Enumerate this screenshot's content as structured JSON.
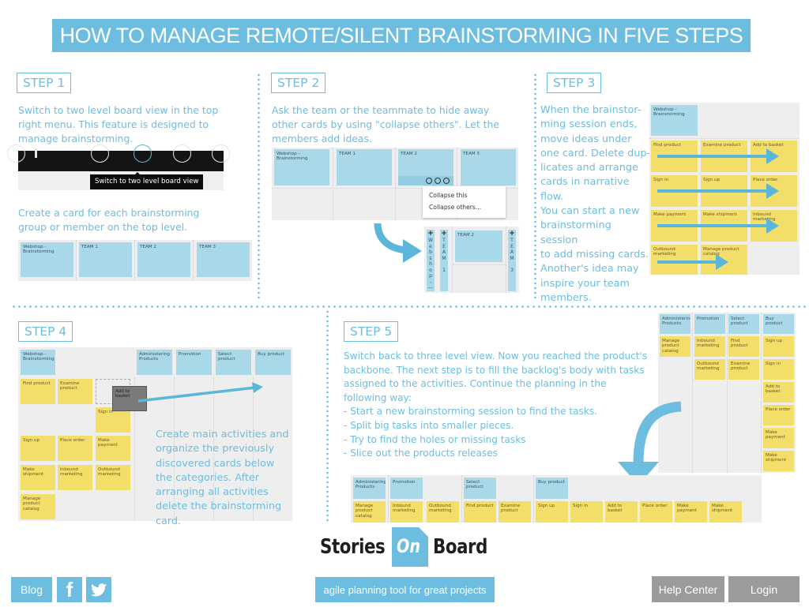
{
  "title": "HOW TO MANAGE REMOTE/SILENT BRAINSTORMING IN FIVE STEPS",
  "colors": {
    "accent": "#6cbde0",
    "card_blue": "#a9d8e8",
    "card_yellow": "#f3de6a",
    "button_gray": "#9b9b9b",
    "board_bg": "#eeeeee"
  },
  "step1": {
    "label": "STEP 1",
    "text1": "Switch to two level board view in the top right menu. This feature is designed to manage brainstorming.",
    "tooltip": "Switch to two level board view",
    "text2": "Create a card for each brainstorming group or member on the top level.",
    "cards": [
      "Webshop - Brainstorming",
      "TEAM 1",
      "TEAM 2",
      "TEAM 3"
    ]
  },
  "step2": {
    "label": "STEP 2",
    "text": "Ask the team or the teammate to hide away other cards by using \"collapse others\". Let the members add ideas.",
    "cards": [
      "Webshop - Brainstorming",
      "TEAM 1",
      "TEAM 2",
      "TEAM 3"
    ],
    "menu": [
      "Collapse this",
      "Collapse others..."
    ],
    "collapsed": [
      {
        "letters": [
          "W",
          "e",
          "b",
          "s",
          "h",
          "o",
          "p",
          "",
          "-",
          "—"
        ]
      },
      {
        "letters": [
          "T",
          "E",
          "A",
          "M",
          "",
          "1"
        ]
      },
      {
        "letters": [
          "T",
          "E",
          "A",
          "M",
          "",
          "3"
        ]
      }
    ],
    "expanded_card": "TEAM 2"
  },
  "step3": {
    "label": "STEP 3",
    "text": "When the brainstor-\nming session ends,\nmove ideas under\none card. Delete dup-\nlicates and arrange\ncards in narrative\nflow.\nYou can start a new\nbrainstorming session\nto add missing cards.\nAnother's idea may\ninspire your team\nmembers.",
    "top_card": "Webshop - Brainstorming",
    "rows": [
      [
        "Find product",
        "Examine product",
        "Add to basket"
      ],
      [
        "Sign in",
        "Sign up",
        "Place order"
      ],
      [
        "Make payment",
        "Make shipment",
        "Inbound marketing"
      ],
      [
        "Outbound marketing",
        "Manage product catalog"
      ]
    ]
  },
  "step4": {
    "label": "STEP 4",
    "text": "Create main activities and organize the previously discovered cards below the categories. After arranging all activities delete the brainstorming card.",
    "top_card": "Webshop - Brainstorming",
    "activities": [
      "Administering Products",
      "Promotion",
      "Select product",
      "Buy product"
    ],
    "dragged_card": "Add to basket",
    "cards": [
      [
        "Find product",
        "Examine product"
      ],
      [
        "Sign in"
      ],
      [
        "Sign up",
        "Place order",
        "Make payment"
      ],
      [
        "Make shipment",
        "Inbound marketing",
        "Outbound marketing"
      ],
      [
        "Manage product catalog"
      ]
    ]
  },
  "step5": {
    "label": "STEP 5",
    "text": "Switch back to three level view. Now you reached the product's backbone. The next step is to fill the backlog's body with tasks assigned to the activities. Continue the planning in the following way:",
    "bullets": [
      "- Start a new brainstorming session to find the tasks.",
      "- Split big tasks into smaller pieces.",
      "- Try to find the holes or missing tasks",
      "- Slice out the products releases"
    ],
    "vertical_board": {
      "activities": [
        "Administering Products",
        "Promotion",
        "Select product",
        "Buy product"
      ],
      "columns": [
        [
          "Manage product catalog"
        ],
        [
          "Inbound marketing",
          "Outbound marketing"
        ],
        [
          "Find product",
          "Examine product"
        ],
        [
          "Sign up",
          "Sign in",
          "Add to basket",
          "Place order",
          "Make payment",
          "Make shipment"
        ]
      ]
    },
    "horizontal_board": {
      "activities": [
        "Administering Products",
        "Promotion",
        "Select product",
        "Buy product"
      ],
      "tasks": [
        "Manage product catalog",
        "Inbound marketing",
        "Outbound marketing",
        "Find product",
        "Examine product",
        "Sign up",
        "Sign in",
        "Add to basket",
        "Place order",
        "Make payment",
        "Make shipment"
      ]
    }
  },
  "footer": {
    "logo": {
      "left": "Stories",
      "middle": "On",
      "right": "Board"
    },
    "tagline": "agile planning tool for great projects",
    "blog": "Blog",
    "facebook_icon": "f",
    "help_center": "Help Center",
    "login": "Login"
  }
}
